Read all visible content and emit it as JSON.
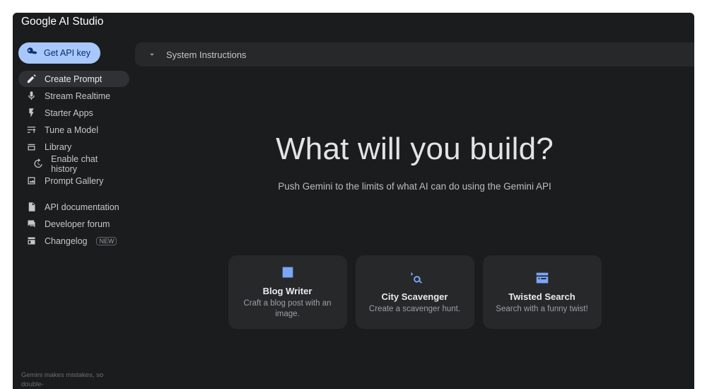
{
  "header": {
    "title": "Google AI Studio"
  },
  "sidebar": {
    "api_key_label": "Get API key",
    "items": [
      {
        "label": "Create Prompt"
      },
      {
        "label": "Stream Realtime"
      },
      {
        "label": "Starter Apps"
      },
      {
        "label": "Tune a Model"
      },
      {
        "label": "Library"
      },
      {
        "label": "Enable chat history"
      },
      {
        "label": "Prompt Gallery"
      }
    ],
    "secondary": [
      {
        "label": "API documentation"
      },
      {
        "label": "Developer forum"
      },
      {
        "label": "Changelog",
        "badge": "NEW"
      }
    ],
    "footnote": "Gemini makes mistakes, so double-"
  },
  "sysbar": {
    "label": "System Instructions"
  },
  "hero": {
    "title": "What will you build?",
    "subtitle": "Push Gemini to the limits of what AI can do using the Gemini API"
  },
  "cards": [
    {
      "title": "Blog Writer",
      "desc": "Craft a blog post with an image."
    },
    {
      "title": "City Scavenger",
      "desc": "Create a scavenger hunt."
    },
    {
      "title": "Twisted Search",
      "desc": "Search with a funny twist!"
    }
  ]
}
